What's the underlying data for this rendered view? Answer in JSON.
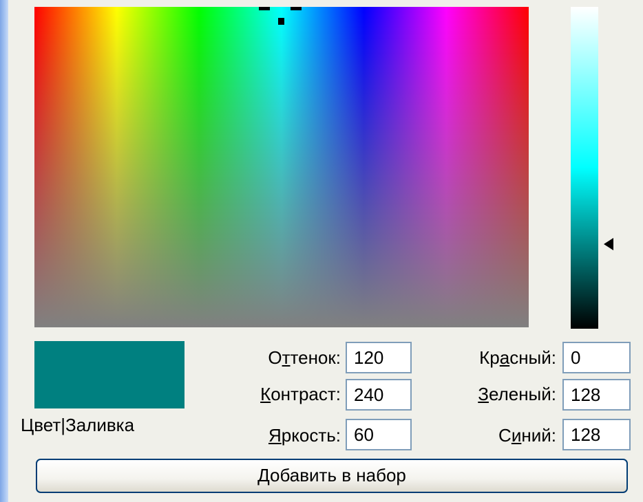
{
  "dialog": {
    "swatch_label": "Цвет|Заливка",
    "swatch_color": "#008080",
    "hue": {
      "label_pre": "О",
      "label_ul": "т",
      "label_post": "тенок:",
      "value": "120"
    },
    "saturation": {
      "label_pre": "",
      "label_ul": "К",
      "label_post": "онтраст:",
      "value": "240"
    },
    "luminance": {
      "label_pre": "",
      "label_ul": "Я",
      "label_post": "ркость:",
      "value": "60"
    },
    "red": {
      "label_pre": "Кр",
      "label_ul": "а",
      "label_post": "сный:",
      "value": "0"
    },
    "green": {
      "label_pre": "",
      "label_ul": "З",
      "label_post": "еленый:",
      "value": "128"
    },
    "blue": {
      "label_pre": "С",
      "label_ul": "и",
      "label_post": "ний:",
      "value": "128"
    },
    "add_button": {
      "label_ul": "Д",
      "label_post": "обавить в набор"
    }
  }
}
